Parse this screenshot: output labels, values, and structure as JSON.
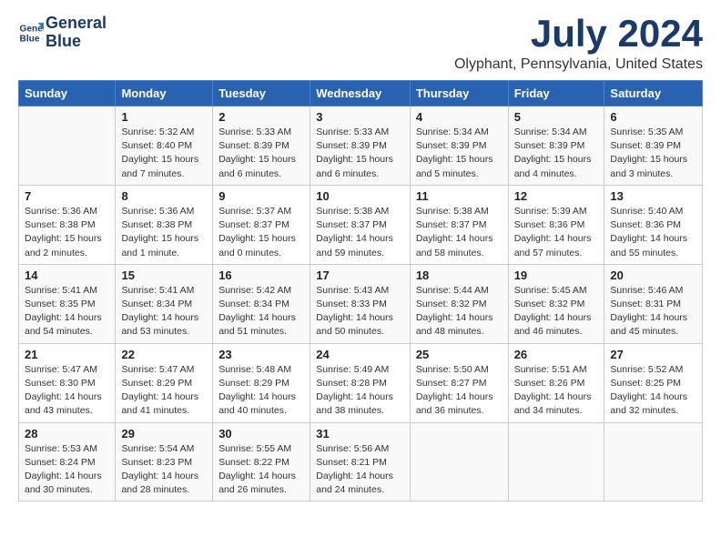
{
  "logo": {
    "line1": "General",
    "line2": "Blue"
  },
  "title": {
    "month_year": "July 2024",
    "location": "Olyphant, Pennsylvania, United States"
  },
  "weekdays": [
    "Sunday",
    "Monday",
    "Tuesday",
    "Wednesday",
    "Thursday",
    "Friday",
    "Saturday"
  ],
  "weeks": [
    [
      {
        "day": "",
        "info": ""
      },
      {
        "day": "1",
        "info": "Sunrise: 5:32 AM\nSunset: 8:40 PM\nDaylight: 15 hours\nand 7 minutes."
      },
      {
        "day": "2",
        "info": "Sunrise: 5:33 AM\nSunset: 8:39 PM\nDaylight: 15 hours\nand 6 minutes."
      },
      {
        "day": "3",
        "info": "Sunrise: 5:33 AM\nSunset: 8:39 PM\nDaylight: 15 hours\nand 6 minutes."
      },
      {
        "day": "4",
        "info": "Sunrise: 5:34 AM\nSunset: 8:39 PM\nDaylight: 15 hours\nand 5 minutes."
      },
      {
        "day": "5",
        "info": "Sunrise: 5:34 AM\nSunset: 8:39 PM\nDaylight: 15 hours\nand 4 minutes."
      },
      {
        "day": "6",
        "info": "Sunrise: 5:35 AM\nSunset: 8:39 PM\nDaylight: 15 hours\nand 3 minutes."
      }
    ],
    [
      {
        "day": "7",
        "info": "Sunrise: 5:36 AM\nSunset: 8:38 PM\nDaylight: 15 hours\nand 2 minutes."
      },
      {
        "day": "8",
        "info": "Sunrise: 5:36 AM\nSunset: 8:38 PM\nDaylight: 15 hours\nand 1 minute."
      },
      {
        "day": "9",
        "info": "Sunrise: 5:37 AM\nSunset: 8:37 PM\nDaylight: 15 hours\nand 0 minutes."
      },
      {
        "day": "10",
        "info": "Sunrise: 5:38 AM\nSunset: 8:37 PM\nDaylight: 14 hours\nand 59 minutes."
      },
      {
        "day": "11",
        "info": "Sunrise: 5:38 AM\nSunset: 8:37 PM\nDaylight: 14 hours\nand 58 minutes."
      },
      {
        "day": "12",
        "info": "Sunrise: 5:39 AM\nSunset: 8:36 PM\nDaylight: 14 hours\nand 57 minutes."
      },
      {
        "day": "13",
        "info": "Sunrise: 5:40 AM\nSunset: 8:36 PM\nDaylight: 14 hours\nand 55 minutes."
      }
    ],
    [
      {
        "day": "14",
        "info": "Sunrise: 5:41 AM\nSunset: 8:35 PM\nDaylight: 14 hours\nand 54 minutes."
      },
      {
        "day": "15",
        "info": "Sunrise: 5:41 AM\nSunset: 8:34 PM\nDaylight: 14 hours\nand 53 minutes."
      },
      {
        "day": "16",
        "info": "Sunrise: 5:42 AM\nSunset: 8:34 PM\nDaylight: 14 hours\nand 51 minutes."
      },
      {
        "day": "17",
        "info": "Sunrise: 5:43 AM\nSunset: 8:33 PM\nDaylight: 14 hours\nand 50 minutes."
      },
      {
        "day": "18",
        "info": "Sunrise: 5:44 AM\nSunset: 8:32 PM\nDaylight: 14 hours\nand 48 minutes."
      },
      {
        "day": "19",
        "info": "Sunrise: 5:45 AM\nSunset: 8:32 PM\nDaylight: 14 hours\nand 46 minutes."
      },
      {
        "day": "20",
        "info": "Sunrise: 5:46 AM\nSunset: 8:31 PM\nDaylight: 14 hours\nand 45 minutes."
      }
    ],
    [
      {
        "day": "21",
        "info": "Sunrise: 5:47 AM\nSunset: 8:30 PM\nDaylight: 14 hours\nand 43 minutes."
      },
      {
        "day": "22",
        "info": "Sunrise: 5:47 AM\nSunset: 8:29 PM\nDaylight: 14 hours\nand 41 minutes."
      },
      {
        "day": "23",
        "info": "Sunrise: 5:48 AM\nSunset: 8:29 PM\nDaylight: 14 hours\nand 40 minutes."
      },
      {
        "day": "24",
        "info": "Sunrise: 5:49 AM\nSunset: 8:28 PM\nDaylight: 14 hours\nand 38 minutes."
      },
      {
        "day": "25",
        "info": "Sunrise: 5:50 AM\nSunset: 8:27 PM\nDaylight: 14 hours\nand 36 minutes."
      },
      {
        "day": "26",
        "info": "Sunrise: 5:51 AM\nSunset: 8:26 PM\nDaylight: 14 hours\nand 34 minutes."
      },
      {
        "day": "27",
        "info": "Sunrise: 5:52 AM\nSunset: 8:25 PM\nDaylight: 14 hours\nand 32 minutes."
      }
    ],
    [
      {
        "day": "28",
        "info": "Sunrise: 5:53 AM\nSunset: 8:24 PM\nDaylight: 14 hours\nand 30 minutes."
      },
      {
        "day": "29",
        "info": "Sunrise: 5:54 AM\nSunset: 8:23 PM\nDaylight: 14 hours\nand 28 minutes."
      },
      {
        "day": "30",
        "info": "Sunrise: 5:55 AM\nSunset: 8:22 PM\nDaylight: 14 hours\nand 26 minutes."
      },
      {
        "day": "31",
        "info": "Sunrise: 5:56 AM\nSunset: 8:21 PM\nDaylight: 14 hours\nand 24 minutes."
      },
      {
        "day": "",
        "info": ""
      },
      {
        "day": "",
        "info": ""
      },
      {
        "day": "",
        "info": ""
      }
    ]
  ]
}
